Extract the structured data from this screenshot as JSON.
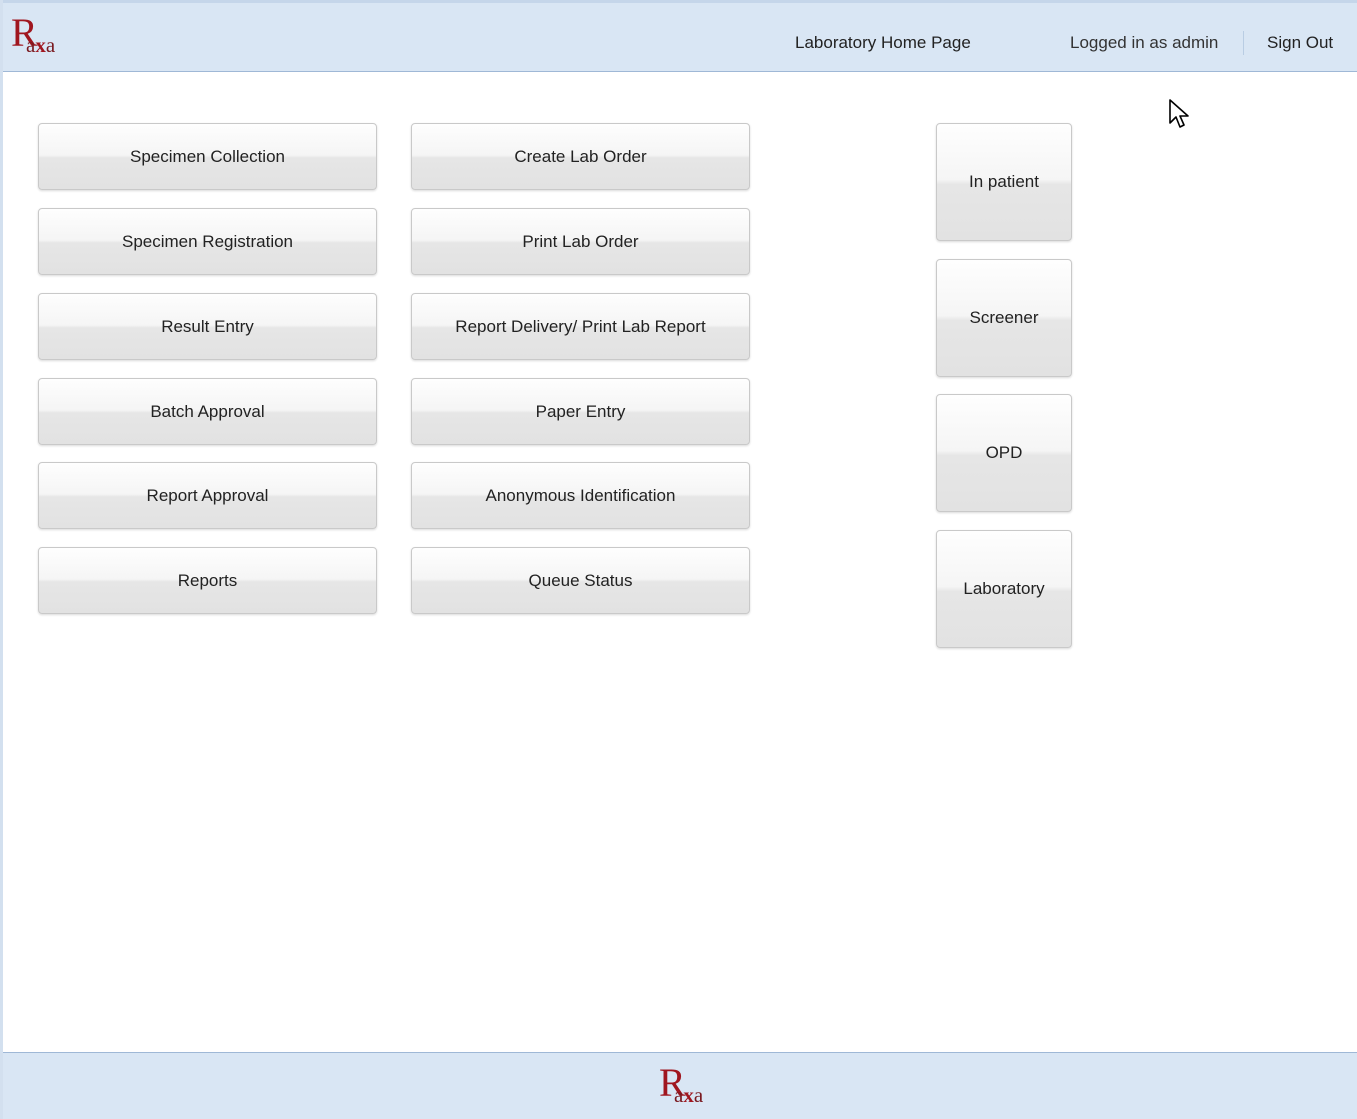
{
  "header": {
    "logo_text_main": "R",
    "logo_text_sub_a": "a",
    "logo_text_sub_x": "x",
    "logo_text_sub_a2": "a",
    "home_link": "Laboratory Home Page",
    "logged_in": "Logged in as admin",
    "sign_out": "Sign Out"
  },
  "left_column": [
    "Specimen Collection",
    "Specimen Registration",
    "Result Entry",
    "Batch Approval",
    "Report Approval",
    "Reports"
  ],
  "middle_column": [
    "Create Lab Order",
    "Print Lab Order",
    "Report Delivery/ Print Lab Report",
    "Paper Entry",
    "Anonymous Identification",
    "Queue Status"
  ],
  "right_column": [
    "In patient",
    "Screener",
    "OPD",
    "Laboratory"
  ],
  "footer": {
    "logo_text_main": "R",
    "logo_text_sub_a": "a",
    "logo_text_sub_x": "x",
    "logo_text_sub_a2": "a"
  },
  "colors": {
    "header_bg": "#d9e6f4",
    "logo_red": "#a0161f",
    "button_text": "#222222"
  }
}
